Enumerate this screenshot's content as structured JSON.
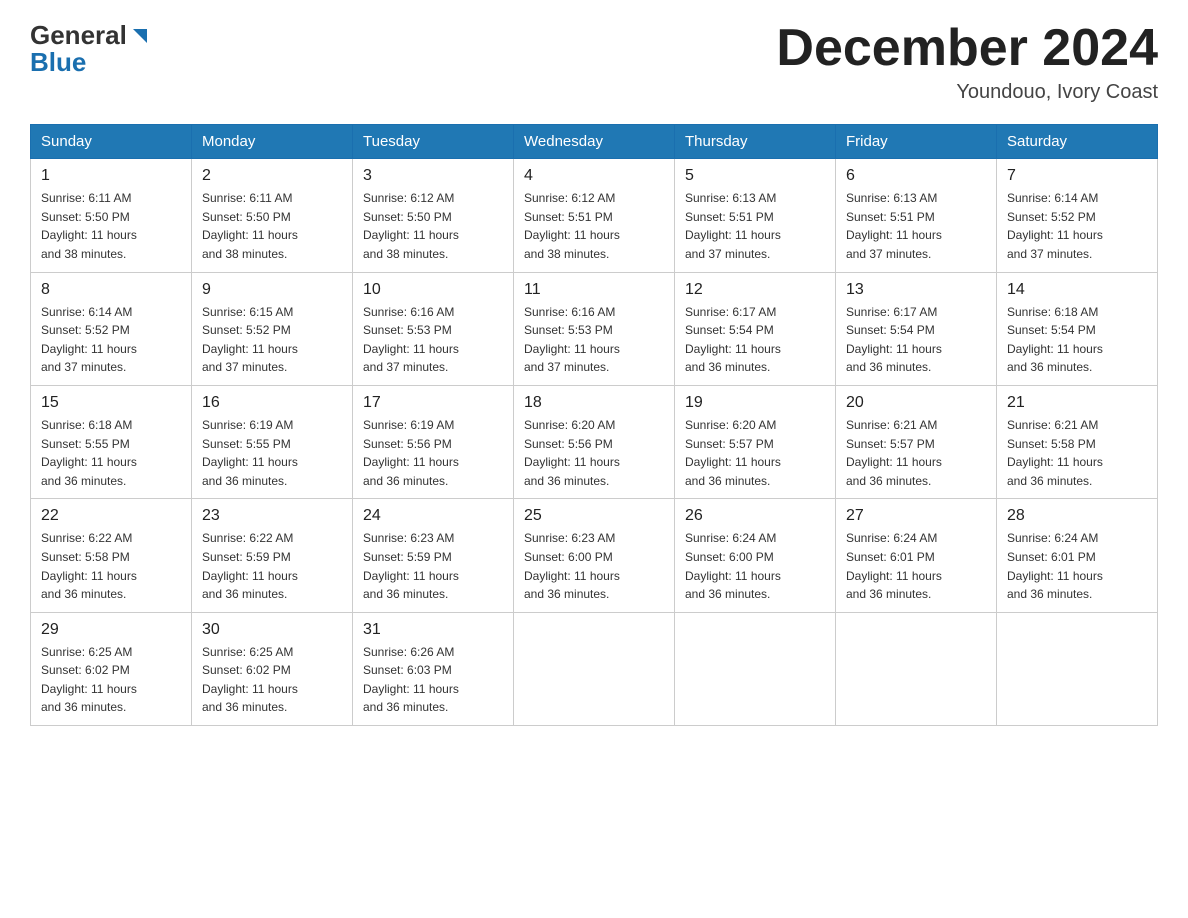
{
  "header": {
    "logo_general": "General",
    "logo_blue": "Blue",
    "month_title": "December 2024",
    "location": "Youndouo, Ivory Coast"
  },
  "days_of_week": [
    "Sunday",
    "Monday",
    "Tuesday",
    "Wednesday",
    "Thursday",
    "Friday",
    "Saturday"
  ],
  "weeks": [
    [
      {
        "day": "1",
        "sunrise": "6:11 AM",
        "sunset": "5:50 PM",
        "daylight": "11 hours and 38 minutes."
      },
      {
        "day": "2",
        "sunrise": "6:11 AM",
        "sunset": "5:50 PM",
        "daylight": "11 hours and 38 minutes."
      },
      {
        "day": "3",
        "sunrise": "6:12 AM",
        "sunset": "5:50 PM",
        "daylight": "11 hours and 38 minutes."
      },
      {
        "day": "4",
        "sunrise": "6:12 AM",
        "sunset": "5:51 PM",
        "daylight": "11 hours and 38 minutes."
      },
      {
        "day": "5",
        "sunrise": "6:13 AM",
        "sunset": "5:51 PM",
        "daylight": "11 hours and 37 minutes."
      },
      {
        "day": "6",
        "sunrise": "6:13 AM",
        "sunset": "5:51 PM",
        "daylight": "11 hours and 37 minutes."
      },
      {
        "day": "7",
        "sunrise": "6:14 AM",
        "sunset": "5:52 PM",
        "daylight": "11 hours and 37 minutes."
      }
    ],
    [
      {
        "day": "8",
        "sunrise": "6:14 AM",
        "sunset": "5:52 PM",
        "daylight": "11 hours and 37 minutes."
      },
      {
        "day": "9",
        "sunrise": "6:15 AM",
        "sunset": "5:52 PM",
        "daylight": "11 hours and 37 minutes."
      },
      {
        "day": "10",
        "sunrise": "6:16 AM",
        "sunset": "5:53 PM",
        "daylight": "11 hours and 37 minutes."
      },
      {
        "day": "11",
        "sunrise": "6:16 AM",
        "sunset": "5:53 PM",
        "daylight": "11 hours and 37 minutes."
      },
      {
        "day": "12",
        "sunrise": "6:17 AM",
        "sunset": "5:54 PM",
        "daylight": "11 hours and 36 minutes."
      },
      {
        "day": "13",
        "sunrise": "6:17 AM",
        "sunset": "5:54 PM",
        "daylight": "11 hours and 36 minutes."
      },
      {
        "day": "14",
        "sunrise": "6:18 AM",
        "sunset": "5:54 PM",
        "daylight": "11 hours and 36 minutes."
      }
    ],
    [
      {
        "day": "15",
        "sunrise": "6:18 AM",
        "sunset": "5:55 PM",
        "daylight": "11 hours and 36 minutes."
      },
      {
        "day": "16",
        "sunrise": "6:19 AM",
        "sunset": "5:55 PM",
        "daylight": "11 hours and 36 minutes."
      },
      {
        "day": "17",
        "sunrise": "6:19 AM",
        "sunset": "5:56 PM",
        "daylight": "11 hours and 36 minutes."
      },
      {
        "day": "18",
        "sunrise": "6:20 AM",
        "sunset": "5:56 PM",
        "daylight": "11 hours and 36 minutes."
      },
      {
        "day": "19",
        "sunrise": "6:20 AM",
        "sunset": "5:57 PM",
        "daylight": "11 hours and 36 minutes."
      },
      {
        "day": "20",
        "sunrise": "6:21 AM",
        "sunset": "5:57 PM",
        "daylight": "11 hours and 36 minutes."
      },
      {
        "day": "21",
        "sunrise": "6:21 AM",
        "sunset": "5:58 PM",
        "daylight": "11 hours and 36 minutes."
      }
    ],
    [
      {
        "day": "22",
        "sunrise": "6:22 AM",
        "sunset": "5:58 PM",
        "daylight": "11 hours and 36 minutes."
      },
      {
        "day": "23",
        "sunrise": "6:22 AM",
        "sunset": "5:59 PM",
        "daylight": "11 hours and 36 minutes."
      },
      {
        "day": "24",
        "sunrise": "6:23 AM",
        "sunset": "5:59 PM",
        "daylight": "11 hours and 36 minutes."
      },
      {
        "day": "25",
        "sunrise": "6:23 AM",
        "sunset": "6:00 PM",
        "daylight": "11 hours and 36 minutes."
      },
      {
        "day": "26",
        "sunrise": "6:24 AM",
        "sunset": "6:00 PM",
        "daylight": "11 hours and 36 minutes."
      },
      {
        "day": "27",
        "sunrise": "6:24 AM",
        "sunset": "6:01 PM",
        "daylight": "11 hours and 36 minutes."
      },
      {
        "day": "28",
        "sunrise": "6:24 AM",
        "sunset": "6:01 PM",
        "daylight": "11 hours and 36 minutes."
      }
    ],
    [
      {
        "day": "29",
        "sunrise": "6:25 AM",
        "sunset": "6:02 PM",
        "daylight": "11 hours and 36 minutes."
      },
      {
        "day": "30",
        "sunrise": "6:25 AM",
        "sunset": "6:02 PM",
        "daylight": "11 hours and 36 minutes."
      },
      {
        "day": "31",
        "sunrise": "6:26 AM",
        "sunset": "6:03 PM",
        "daylight": "11 hours and 36 minutes."
      },
      null,
      null,
      null,
      null
    ]
  ],
  "labels": {
    "sunrise": "Sunrise:",
    "sunset": "Sunset:",
    "daylight": "Daylight:"
  }
}
